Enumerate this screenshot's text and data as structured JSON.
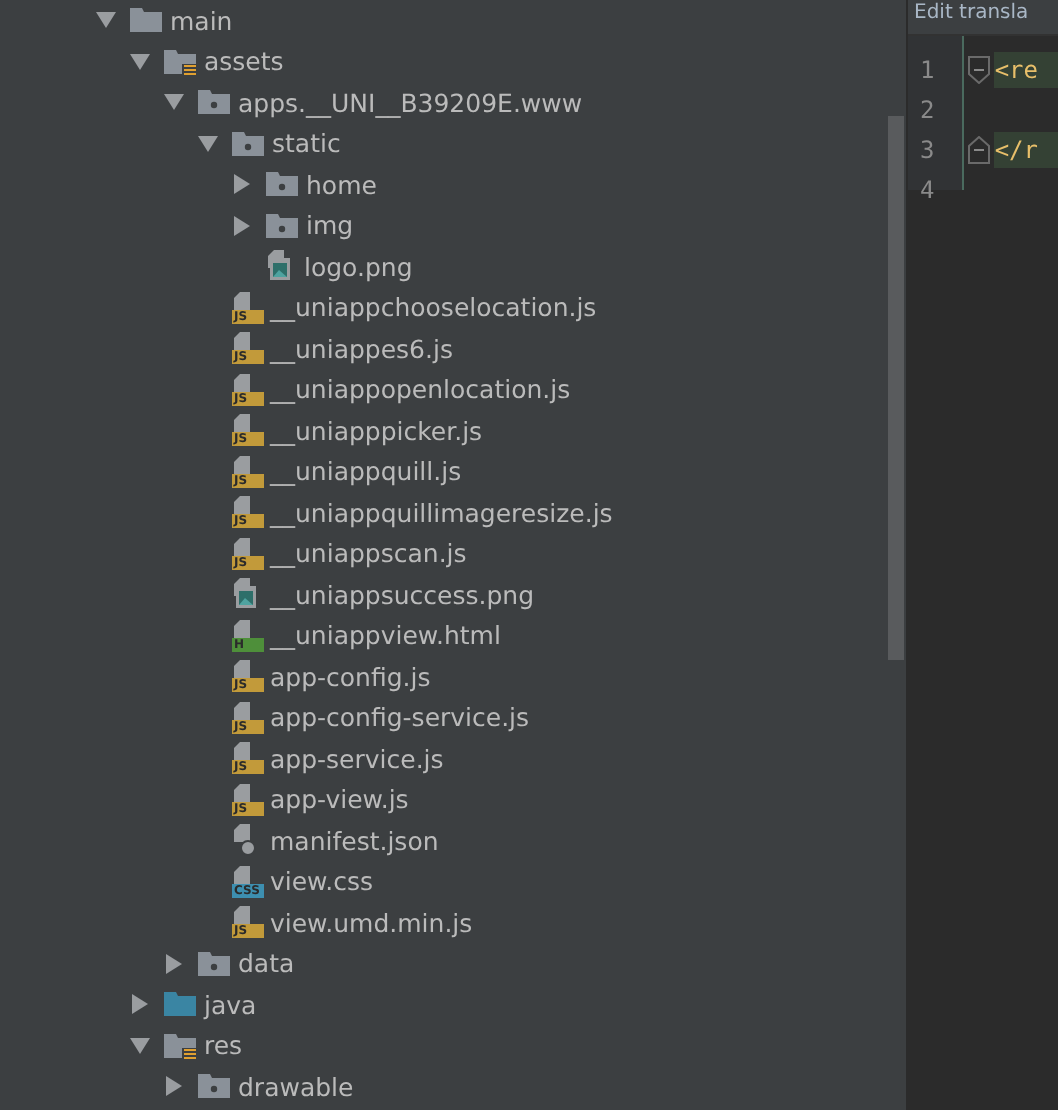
{
  "project_tree": [
    {
      "name": "main",
      "kind": "folder",
      "expanded": true,
      "children": [
        {
          "name": "assets",
          "kind": "resource_folder",
          "expanded": true,
          "children": [
            {
              "name": "apps.__UNI__B39209E.www",
              "kind": "package_folder",
              "expanded": true,
              "children": [
                {
                  "name": "static",
                  "kind": "package_folder",
                  "expanded": true,
                  "children": [
                    {
                      "name": "home",
                      "kind": "package_folder",
                      "expanded": false
                    },
                    {
                      "name": "img",
                      "kind": "package_folder",
                      "expanded": false
                    },
                    {
                      "name": "logo.png",
                      "kind": "image"
                    }
                  ]
                },
                {
                  "name": "__uniappchooselocation.js",
                  "kind": "script",
                  "badge": "JS"
                },
                {
                  "name": "__uniappes6.js",
                  "kind": "script",
                  "badge": "JS"
                },
                {
                  "name": "__uniappopenlocation.js",
                  "kind": "script",
                  "badge": "JS"
                },
                {
                  "name": "__uniapppicker.js",
                  "kind": "script",
                  "badge": "JS"
                },
                {
                  "name": "__uniappquill.js",
                  "kind": "script",
                  "badge": "JS"
                },
                {
                  "name": "__uniappquillimageresize.js",
                  "kind": "script",
                  "badge": "JS"
                },
                {
                  "name": "__uniappscan.js",
                  "kind": "script",
                  "badge": "JS"
                },
                {
                  "name": "__uniappsuccess.png",
                  "kind": "image"
                },
                {
                  "name": "__uniappview.html",
                  "kind": "html",
                  "badge": "H"
                },
                {
                  "name": "app-config.js",
                  "kind": "script",
                  "badge": "JS"
                },
                {
                  "name": "app-config-service.js",
                  "kind": "script",
                  "badge": "JS"
                },
                {
                  "name": "app-service.js",
                  "kind": "script",
                  "badge": "JS"
                },
                {
                  "name": "app-view.js",
                  "kind": "script",
                  "badge": "JS"
                },
                {
                  "name": "manifest.json",
                  "kind": "json"
                },
                {
                  "name": "view.css",
                  "kind": "style",
                  "badge": "CSS"
                },
                {
                  "name": "view.umd.min.js",
                  "kind": "script",
                  "badge": "JS"
                }
              ]
            },
            {
              "name": "data",
              "kind": "package_folder",
              "expanded": false
            }
          ]
        },
        {
          "name": "java",
          "kind": "source_folder",
          "expanded": false
        },
        {
          "name": "res",
          "kind": "resource_folder",
          "expanded": true,
          "children": [
            {
              "name": "drawable",
              "kind": "package_folder",
              "expanded": false
            }
          ]
        }
      ]
    }
  ],
  "editor": {
    "tab": "Edit transla",
    "lines": [
      {
        "number": "1",
        "code": "<re",
        "fold_start": true,
        "fold_end": false
      },
      {
        "number": "2",
        "fold_start": false,
        "fold_end": false
      },
      {
        "number": "3",
        "code": "</r",
        "fold_start": false,
        "fold_end": true
      },
      {
        "number": "4",
        "fold_start": false,
        "fold_end": false
      }
    ]
  }
}
